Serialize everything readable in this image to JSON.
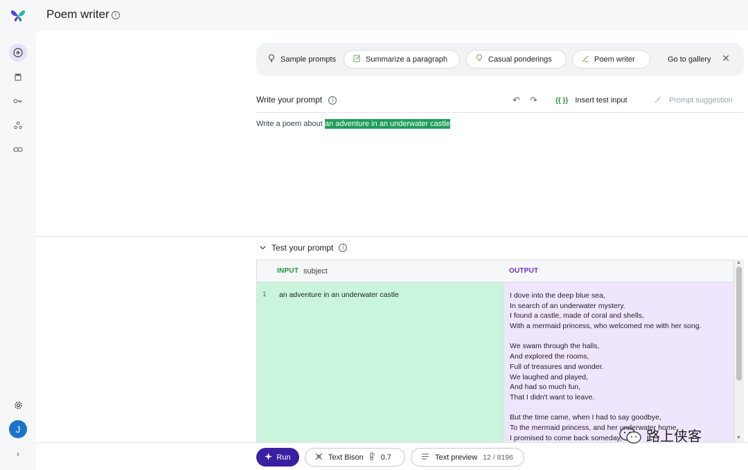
{
  "header": {
    "title": "Poem writer"
  },
  "rail": {
    "items": [
      "new-prompt-icon",
      "library-icon",
      "api-key-icon",
      "share-icon",
      "link-icon"
    ],
    "settings_icon": "gear-icon",
    "avatar_letter": "J",
    "expand_icon": "chevron-right-icon"
  },
  "samples": {
    "label": "Sample prompts",
    "chips": [
      {
        "label": "Summarize a paragraph",
        "icon": "edit-note-icon"
      },
      {
        "label": "Casual ponderings",
        "icon": "lightbulb-icon"
      },
      {
        "label": "Poem writer",
        "icon": "quill-icon"
      }
    ],
    "gallery": "Go to gallery"
  },
  "editor": {
    "label": "Write your prompt",
    "insert_test_input": "Insert test input",
    "insert_glyph": "{{ }}",
    "prompt_suggestion": "Prompt suggestion",
    "prompt_prefix": "Write a poem about ",
    "prompt_variable": "an adventure in an underwater castle"
  },
  "test": {
    "label": "Test your prompt",
    "input_header": "INPUT",
    "input_column": "subject",
    "output_header": "OUTPUT",
    "rows": [
      {
        "num": "1",
        "subject": "an adventure in an underwater castle",
        "output": [
          "I dove into the deep blue sea,",
          "In search of an underwater mystery.",
          "I found a castle, made of coral and shells,",
          "With a mermaid princess, who welcomed me with her song.",
          "",
          "We swam through the halls,",
          "And explored the rooms,",
          "Full of treasures and wonder.",
          "We laughed and played,",
          "And had so much fun,",
          "That I didn't want to leave.",
          "",
          "But the time came, when I had to say goodbye,",
          "To the mermaid princess, and her underwater home.",
          "I promised to come back someday,"
        ]
      }
    ]
  },
  "bottom": {
    "run": "Run",
    "model": "Text Bison",
    "temperature": "0.7",
    "preview": "Text preview",
    "tokens": "12 / 8196"
  },
  "watermark": {
    "text": "路上侠客"
  },
  "colors": {
    "accent": "#3b1fa3",
    "input_bg": "#c9f5dd",
    "output_bg": "#efe6fd",
    "highlight": "#1e9e5a"
  }
}
